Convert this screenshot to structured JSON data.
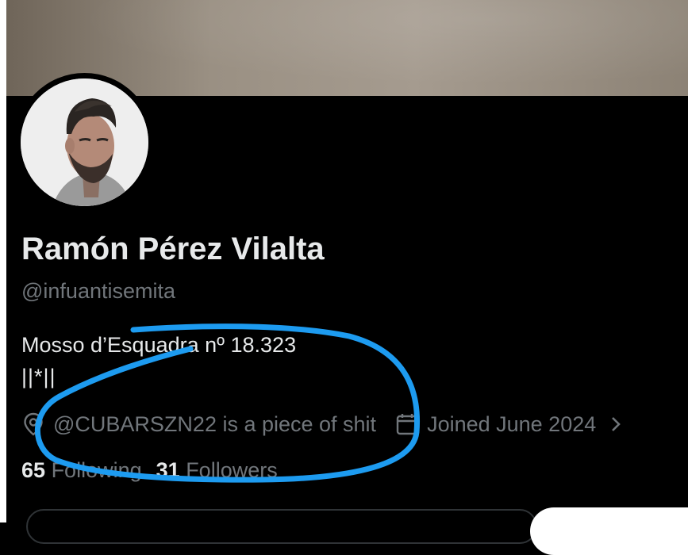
{
  "profile": {
    "display_name": "Ramón Pérez Vilalta",
    "handle": "@infuantisemita",
    "bio_line1": "Mosso d’Esquadra nº 18.323",
    "bio_line2": "||*||",
    "location": "@CUBARSZN22 is a piece of shit",
    "joined": "Joined June 2024"
  },
  "stats": {
    "following_count": "65",
    "following_label": "Following",
    "followers_count": "31",
    "followers_label": "Followers"
  },
  "icons": {
    "location": "location-pin-icon",
    "calendar": "calendar-icon",
    "chevron": "chevron-right-icon"
  },
  "colors": {
    "background": "#000000",
    "text_primary": "#e7e9ea",
    "text_secondary": "#71767b",
    "annotation_stroke": "#1d9bf0"
  }
}
